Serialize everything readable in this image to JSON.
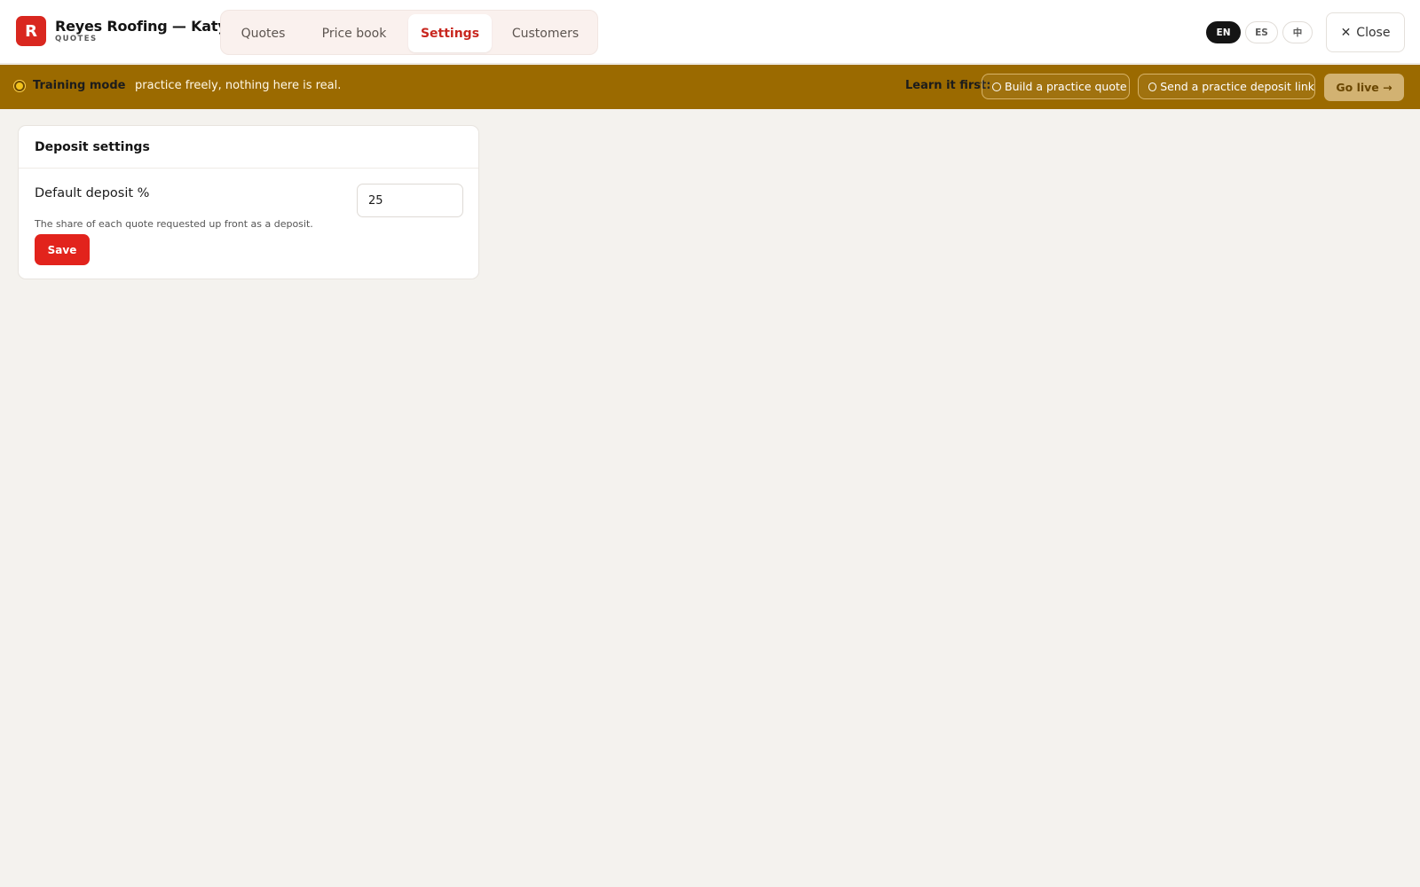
{
  "brand": {
    "logo_letter": "R",
    "name": "Reyes Roofing — Katy",
    "subtitle": "QUOTES",
    "accent_color": "#d9271f"
  },
  "tabs": [
    {
      "label": "Quotes",
      "active": false
    },
    {
      "label": "Price book",
      "active": false
    },
    {
      "label": "Settings",
      "active": true
    },
    {
      "label": "Customers",
      "active": false
    }
  ],
  "languages": [
    {
      "label": "EN",
      "active": true
    },
    {
      "label": "ES",
      "active": false
    },
    {
      "label": "中",
      "active": false
    }
  ],
  "close_button": {
    "icon": "close-icon",
    "glyph": "✕",
    "label": "Close"
  },
  "banner": {
    "background_color": "#9b6a00",
    "title": "Training mode",
    "text": "practice freely, nothing here is real.",
    "learn_label": "Learn it first:",
    "tasks": [
      {
        "label": "Build a practice quote",
        "done": false
      },
      {
        "label": "Send a practice deposit link",
        "done": false
      }
    ],
    "go_live_label": "Go live →"
  },
  "deposit_settings": {
    "title": "Deposit settings",
    "field_label": "Default deposit %",
    "field_value": "25",
    "help_text": "The share of each quote requested up front as a deposit.",
    "save_label": "Save"
  }
}
